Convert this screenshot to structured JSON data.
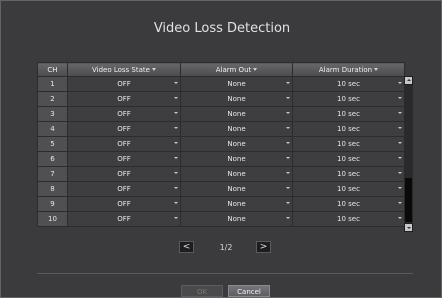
{
  "title": "Video Loss Detection",
  "columns": {
    "ch": "CH",
    "state": "Video Loss State",
    "alarm": "Alarm Out",
    "duration": "Alarm Duration"
  },
  "rows": [
    {
      "ch": "1",
      "state": "OFF",
      "alarm": "None",
      "duration": "10 sec"
    },
    {
      "ch": "2",
      "state": "OFF",
      "alarm": "None",
      "duration": "10 sec"
    },
    {
      "ch": "3",
      "state": "OFF",
      "alarm": "None",
      "duration": "10 sec"
    },
    {
      "ch": "4",
      "state": "OFF",
      "alarm": "None",
      "duration": "10 sec"
    },
    {
      "ch": "5",
      "state": "OFF",
      "alarm": "None",
      "duration": "10 sec"
    },
    {
      "ch": "6",
      "state": "OFF",
      "alarm": "None",
      "duration": "10 sec"
    },
    {
      "ch": "7",
      "state": "OFF",
      "alarm": "None",
      "duration": "10 sec"
    },
    {
      "ch": "8",
      "state": "OFF",
      "alarm": "None",
      "duration": "10 sec"
    },
    {
      "ch": "9",
      "state": "OFF",
      "alarm": "None",
      "duration": "10 sec"
    },
    {
      "ch": "10",
      "state": "OFF",
      "alarm": "None",
      "duration": "10 sec"
    }
  ],
  "pager": {
    "prev": "<",
    "next": ">",
    "label": "1/2"
  },
  "buttons": {
    "ok": "OK",
    "cancel": "Cancel"
  }
}
